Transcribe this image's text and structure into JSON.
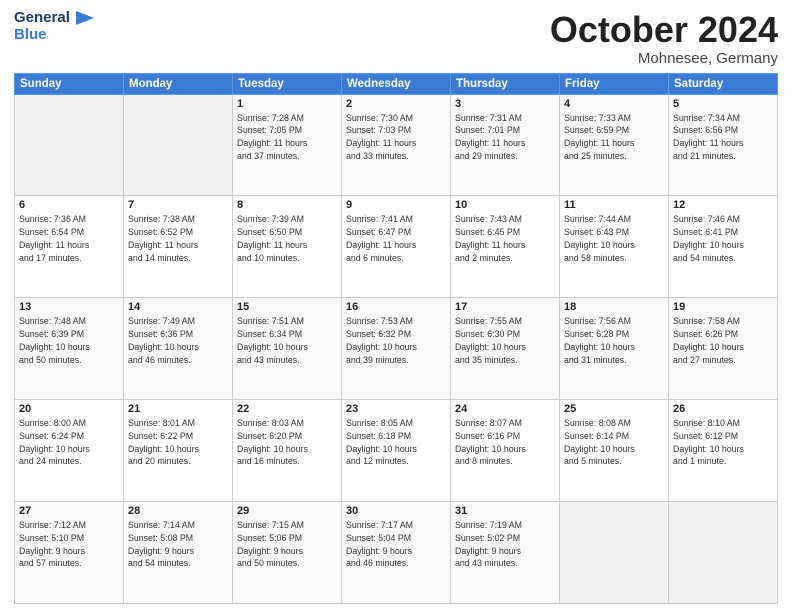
{
  "header": {
    "logo_line1": "General",
    "logo_line2": "Blue",
    "month": "October 2024",
    "location": "Mohnesee, Germany"
  },
  "weekdays": [
    "Sunday",
    "Monday",
    "Tuesday",
    "Wednesday",
    "Thursday",
    "Friday",
    "Saturday"
  ],
  "weeks": [
    [
      {
        "day": "",
        "info": ""
      },
      {
        "day": "",
        "info": ""
      },
      {
        "day": "1",
        "info": "Sunrise: 7:28 AM\nSunset: 7:05 PM\nDaylight: 11 hours\nand 37 minutes."
      },
      {
        "day": "2",
        "info": "Sunrise: 7:30 AM\nSunset: 7:03 PM\nDaylight: 11 hours\nand 33 minutes."
      },
      {
        "day": "3",
        "info": "Sunrise: 7:31 AM\nSunset: 7:01 PM\nDaylight: 11 hours\nand 29 minutes."
      },
      {
        "day": "4",
        "info": "Sunrise: 7:33 AM\nSunset: 6:59 PM\nDaylight: 11 hours\nand 25 minutes."
      },
      {
        "day": "5",
        "info": "Sunrise: 7:34 AM\nSunset: 6:56 PM\nDaylight: 11 hours\nand 21 minutes."
      }
    ],
    [
      {
        "day": "6",
        "info": "Sunrise: 7:36 AM\nSunset: 6:54 PM\nDaylight: 11 hours\nand 17 minutes."
      },
      {
        "day": "7",
        "info": "Sunrise: 7:38 AM\nSunset: 6:52 PM\nDaylight: 11 hours\nand 14 minutes."
      },
      {
        "day": "8",
        "info": "Sunrise: 7:39 AM\nSunset: 6:50 PM\nDaylight: 11 hours\nand 10 minutes."
      },
      {
        "day": "9",
        "info": "Sunrise: 7:41 AM\nSunset: 6:47 PM\nDaylight: 11 hours\nand 6 minutes."
      },
      {
        "day": "10",
        "info": "Sunrise: 7:43 AM\nSunset: 6:45 PM\nDaylight: 11 hours\nand 2 minutes."
      },
      {
        "day": "11",
        "info": "Sunrise: 7:44 AM\nSunset: 6:43 PM\nDaylight: 10 hours\nand 58 minutes."
      },
      {
        "day": "12",
        "info": "Sunrise: 7:46 AM\nSunset: 6:41 PM\nDaylight: 10 hours\nand 54 minutes."
      }
    ],
    [
      {
        "day": "13",
        "info": "Sunrise: 7:48 AM\nSunset: 6:39 PM\nDaylight: 10 hours\nand 50 minutes."
      },
      {
        "day": "14",
        "info": "Sunrise: 7:49 AM\nSunset: 6:36 PM\nDaylight: 10 hours\nand 46 minutes."
      },
      {
        "day": "15",
        "info": "Sunrise: 7:51 AM\nSunset: 6:34 PM\nDaylight: 10 hours\nand 43 minutes."
      },
      {
        "day": "16",
        "info": "Sunrise: 7:53 AM\nSunset: 6:32 PM\nDaylight: 10 hours\nand 39 minutes."
      },
      {
        "day": "17",
        "info": "Sunrise: 7:55 AM\nSunset: 6:30 PM\nDaylight: 10 hours\nand 35 minutes."
      },
      {
        "day": "18",
        "info": "Sunrise: 7:56 AM\nSunset: 6:28 PM\nDaylight: 10 hours\nand 31 minutes."
      },
      {
        "day": "19",
        "info": "Sunrise: 7:58 AM\nSunset: 6:26 PM\nDaylight: 10 hours\nand 27 minutes."
      }
    ],
    [
      {
        "day": "20",
        "info": "Sunrise: 8:00 AM\nSunset: 6:24 PM\nDaylight: 10 hours\nand 24 minutes."
      },
      {
        "day": "21",
        "info": "Sunrise: 8:01 AM\nSunset: 6:22 PM\nDaylight: 10 hours\nand 20 minutes."
      },
      {
        "day": "22",
        "info": "Sunrise: 8:03 AM\nSunset: 6:20 PM\nDaylight: 10 hours\nand 16 minutes."
      },
      {
        "day": "23",
        "info": "Sunrise: 8:05 AM\nSunset: 6:18 PM\nDaylight: 10 hours\nand 12 minutes."
      },
      {
        "day": "24",
        "info": "Sunrise: 8:07 AM\nSunset: 6:16 PM\nDaylight: 10 hours\nand 8 minutes."
      },
      {
        "day": "25",
        "info": "Sunrise: 8:08 AM\nSunset: 6:14 PM\nDaylight: 10 hours\nand 5 minutes."
      },
      {
        "day": "26",
        "info": "Sunrise: 8:10 AM\nSunset: 6:12 PM\nDaylight: 10 hours\nand 1 minute."
      }
    ],
    [
      {
        "day": "27",
        "info": "Sunrise: 7:12 AM\nSunset: 5:10 PM\nDaylight: 9 hours\nand 57 minutes."
      },
      {
        "day": "28",
        "info": "Sunrise: 7:14 AM\nSunset: 5:08 PM\nDaylight: 9 hours\nand 54 minutes."
      },
      {
        "day": "29",
        "info": "Sunrise: 7:15 AM\nSunset: 5:06 PM\nDaylight: 9 hours\nand 50 minutes."
      },
      {
        "day": "30",
        "info": "Sunrise: 7:17 AM\nSunset: 5:04 PM\nDaylight: 9 hours\nand 46 minutes."
      },
      {
        "day": "31",
        "info": "Sunrise: 7:19 AM\nSunset: 5:02 PM\nDaylight: 9 hours\nand 43 minutes."
      },
      {
        "day": "",
        "info": ""
      },
      {
        "day": "",
        "info": ""
      }
    ]
  ]
}
